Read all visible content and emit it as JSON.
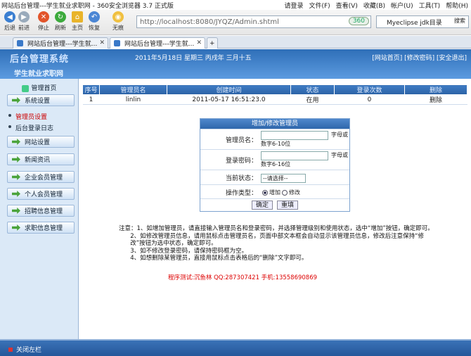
{
  "browser": {
    "window_title": "网站后台管理---学生就业求职网 - 360安全浏览器 3.7 正式版",
    "menu": [
      "请登录",
      "文件(F)",
      "查看(V)",
      "收藏(B)",
      "帐户(U)",
      "工具(T)",
      "帮助(H)"
    ],
    "nav": [
      "后退",
      "前进",
      "停止",
      "刷新",
      "主页",
      "恢复",
      "无痕"
    ],
    "address": "http://localhost:8080/JYQZ/Admin.shtml",
    "go_label": "360",
    "search_value": "Myeclipse jdk目录",
    "search_button": "搜索",
    "tabs": [
      "网站后台管理---学生就...",
      "网站后台管理---学生就..."
    ]
  },
  "header": {
    "logo": "后台管理系统",
    "subtitle": "学生就业求职网",
    "date": "2011年5月18日  星期三  丙戌年  三月十五",
    "links": "[网站首页]  [修改密码]  [安全退出]"
  },
  "sidebar": {
    "head": "管理首页",
    "items": [
      "系统设置",
      "网站设置",
      "新闻资讯",
      "企业会员管理",
      "个人会员管理",
      "招聘信息管理",
      "求职信息管理"
    ],
    "sub_items": [
      "管理员设置",
      "后台登录日志"
    ]
  },
  "table": {
    "headers": [
      "序号",
      "管理员名",
      "创建时间",
      "状态",
      "登录次数",
      "删除"
    ],
    "rows": [
      [
        "1",
        "linlin",
        "2011-05-17 16:51:23.0",
        "在用",
        "0",
        "删除"
      ]
    ]
  },
  "form": {
    "title": "增加/修改管理员",
    "name_label": "管理员名：",
    "name_hint_1": "字母或",
    "name_hint_2": "数字6-10位",
    "pwd_label": "登录密码：",
    "pwd_hint_1": "字母或",
    "pwd_hint_2": "数字6-16位",
    "status_label": "当前状态：",
    "status_value": "--请选择--",
    "type_label": "操作类型：",
    "opt_add": "增加",
    "opt_edit": "修改",
    "ok": "确定",
    "reset": "重填"
  },
  "notes": {
    "line1": "注意：1、如增加管理员，请直接输入管理员名和登录密码，并选择管理级别和使用状态，选中“增加”按钮，确定即可。",
    "line2": "      2、如修改管理员信息，请用鼠标点击管理员名，页面中部文本框会自动显示该管理员信息，修改后注意保持“修",
    "line3": "      改”按钮为选中状态，确定即可。",
    "line4": "      3、如不修改登录密码，请保持密码框为空。",
    "line5": "      4、如想删除某管理员，直接用鼠标点击表格后的“删除”文字即可。",
    "credit": "程序测试:沉鱼林  QQ:287307421  手机:13558690869"
  },
  "footer": {
    "close": "关闭左栏"
  },
  "colors": {
    "banner": "#2f6fb8",
    "table_header": "#2b62a6",
    "credit": "#dd0000"
  }
}
